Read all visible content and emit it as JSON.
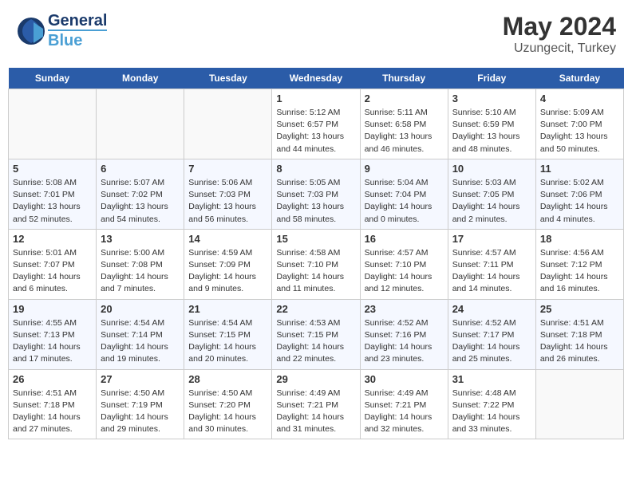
{
  "header": {
    "logo_general": "General",
    "logo_blue": "Blue",
    "month": "May 2024",
    "location": "Uzungecit, Turkey"
  },
  "days_of_week": [
    "Sunday",
    "Monday",
    "Tuesday",
    "Wednesday",
    "Thursday",
    "Friday",
    "Saturday"
  ],
  "weeks": [
    [
      {
        "day": "",
        "info": ""
      },
      {
        "day": "",
        "info": ""
      },
      {
        "day": "",
        "info": ""
      },
      {
        "day": "1",
        "sunrise": "Sunrise: 5:12 AM",
        "sunset": "Sunset: 6:57 PM",
        "daylight": "Daylight: 13 hours and 44 minutes."
      },
      {
        "day": "2",
        "sunrise": "Sunrise: 5:11 AM",
        "sunset": "Sunset: 6:58 PM",
        "daylight": "Daylight: 13 hours and 46 minutes."
      },
      {
        "day": "3",
        "sunrise": "Sunrise: 5:10 AM",
        "sunset": "Sunset: 6:59 PM",
        "daylight": "Daylight: 13 hours and 48 minutes."
      },
      {
        "day": "4",
        "sunrise": "Sunrise: 5:09 AM",
        "sunset": "Sunset: 7:00 PM",
        "daylight": "Daylight: 13 hours and 50 minutes."
      }
    ],
    [
      {
        "day": "5",
        "sunrise": "Sunrise: 5:08 AM",
        "sunset": "Sunset: 7:01 PM",
        "daylight": "Daylight: 13 hours and 52 minutes."
      },
      {
        "day": "6",
        "sunrise": "Sunrise: 5:07 AM",
        "sunset": "Sunset: 7:02 PM",
        "daylight": "Daylight: 13 hours and 54 minutes."
      },
      {
        "day": "7",
        "sunrise": "Sunrise: 5:06 AM",
        "sunset": "Sunset: 7:03 PM",
        "daylight": "Daylight: 13 hours and 56 minutes."
      },
      {
        "day": "8",
        "sunrise": "Sunrise: 5:05 AM",
        "sunset": "Sunset: 7:03 PM",
        "daylight": "Daylight: 13 hours and 58 minutes."
      },
      {
        "day": "9",
        "sunrise": "Sunrise: 5:04 AM",
        "sunset": "Sunset: 7:04 PM",
        "daylight": "Daylight: 14 hours and 0 minutes."
      },
      {
        "day": "10",
        "sunrise": "Sunrise: 5:03 AM",
        "sunset": "Sunset: 7:05 PM",
        "daylight": "Daylight: 14 hours and 2 minutes."
      },
      {
        "day": "11",
        "sunrise": "Sunrise: 5:02 AM",
        "sunset": "Sunset: 7:06 PM",
        "daylight": "Daylight: 14 hours and 4 minutes."
      }
    ],
    [
      {
        "day": "12",
        "sunrise": "Sunrise: 5:01 AM",
        "sunset": "Sunset: 7:07 PM",
        "daylight": "Daylight: 14 hours and 6 minutes."
      },
      {
        "day": "13",
        "sunrise": "Sunrise: 5:00 AM",
        "sunset": "Sunset: 7:08 PM",
        "daylight": "Daylight: 14 hours and 7 minutes."
      },
      {
        "day": "14",
        "sunrise": "Sunrise: 4:59 AM",
        "sunset": "Sunset: 7:09 PM",
        "daylight": "Daylight: 14 hours and 9 minutes."
      },
      {
        "day": "15",
        "sunrise": "Sunrise: 4:58 AM",
        "sunset": "Sunset: 7:10 PM",
        "daylight": "Daylight: 14 hours and 11 minutes."
      },
      {
        "day": "16",
        "sunrise": "Sunrise: 4:57 AM",
        "sunset": "Sunset: 7:10 PM",
        "daylight": "Daylight: 14 hours and 12 minutes."
      },
      {
        "day": "17",
        "sunrise": "Sunrise: 4:57 AM",
        "sunset": "Sunset: 7:11 PM",
        "daylight": "Daylight: 14 hours and 14 minutes."
      },
      {
        "day": "18",
        "sunrise": "Sunrise: 4:56 AM",
        "sunset": "Sunset: 7:12 PM",
        "daylight": "Daylight: 14 hours and 16 minutes."
      }
    ],
    [
      {
        "day": "19",
        "sunrise": "Sunrise: 4:55 AM",
        "sunset": "Sunset: 7:13 PM",
        "daylight": "Daylight: 14 hours and 17 minutes."
      },
      {
        "day": "20",
        "sunrise": "Sunrise: 4:54 AM",
        "sunset": "Sunset: 7:14 PM",
        "daylight": "Daylight: 14 hours and 19 minutes."
      },
      {
        "day": "21",
        "sunrise": "Sunrise: 4:54 AM",
        "sunset": "Sunset: 7:15 PM",
        "daylight": "Daylight: 14 hours and 20 minutes."
      },
      {
        "day": "22",
        "sunrise": "Sunrise: 4:53 AM",
        "sunset": "Sunset: 7:15 PM",
        "daylight": "Daylight: 14 hours and 22 minutes."
      },
      {
        "day": "23",
        "sunrise": "Sunrise: 4:52 AM",
        "sunset": "Sunset: 7:16 PM",
        "daylight": "Daylight: 14 hours and 23 minutes."
      },
      {
        "day": "24",
        "sunrise": "Sunrise: 4:52 AM",
        "sunset": "Sunset: 7:17 PM",
        "daylight": "Daylight: 14 hours and 25 minutes."
      },
      {
        "day": "25",
        "sunrise": "Sunrise: 4:51 AM",
        "sunset": "Sunset: 7:18 PM",
        "daylight": "Daylight: 14 hours and 26 minutes."
      }
    ],
    [
      {
        "day": "26",
        "sunrise": "Sunrise: 4:51 AM",
        "sunset": "Sunset: 7:18 PM",
        "daylight": "Daylight: 14 hours and 27 minutes."
      },
      {
        "day": "27",
        "sunrise": "Sunrise: 4:50 AM",
        "sunset": "Sunset: 7:19 PM",
        "daylight": "Daylight: 14 hours and 29 minutes."
      },
      {
        "day": "28",
        "sunrise": "Sunrise: 4:50 AM",
        "sunset": "Sunset: 7:20 PM",
        "daylight": "Daylight: 14 hours and 30 minutes."
      },
      {
        "day": "29",
        "sunrise": "Sunrise: 4:49 AM",
        "sunset": "Sunset: 7:21 PM",
        "daylight": "Daylight: 14 hours and 31 minutes."
      },
      {
        "day": "30",
        "sunrise": "Sunrise: 4:49 AM",
        "sunset": "Sunset: 7:21 PM",
        "daylight": "Daylight: 14 hours and 32 minutes."
      },
      {
        "day": "31",
        "sunrise": "Sunrise: 4:48 AM",
        "sunset": "Sunset: 7:22 PM",
        "daylight": "Daylight: 14 hours and 33 minutes."
      },
      {
        "day": "",
        "info": ""
      }
    ]
  ]
}
